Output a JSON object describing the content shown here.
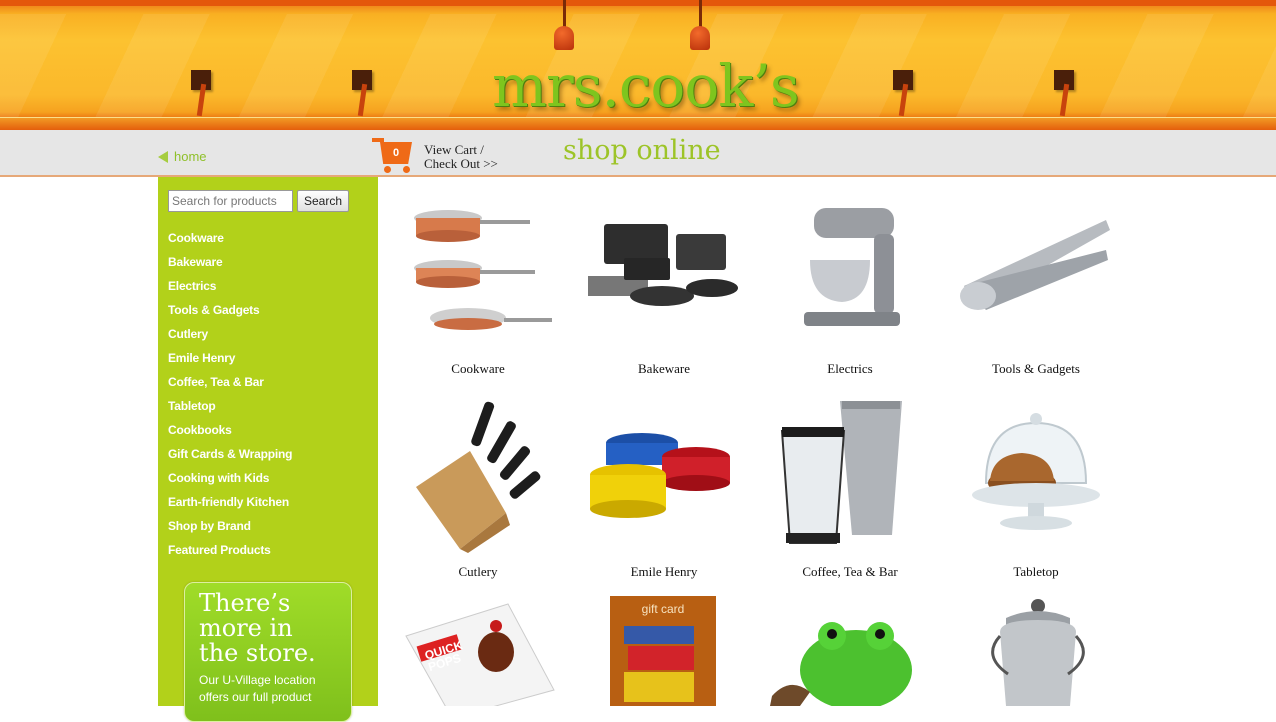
{
  "brand": {
    "logo_text": "mrs.cook’s"
  },
  "nav": {
    "home_label": "home",
    "cart_count": "0",
    "cart_line1": "View Cart /",
    "cart_line2": "Check Out >>",
    "section_title": "shop online"
  },
  "search": {
    "placeholder": "Search for products",
    "button_label": "Search"
  },
  "sidebar": {
    "categories": [
      "Cookware",
      "Bakeware",
      "Electrics",
      "Tools & Gadgets",
      "Cutlery",
      "Emile Henry",
      "Coffee, Tea & Bar",
      "Tabletop",
      "Cookbooks",
      "Gift Cards & Wrapping",
      "Cooking with Kids",
      "Earth-friendly Kitchen",
      "Shop by Brand",
      "Featured Products"
    ],
    "promo": {
      "headline_1": "There’s",
      "headline_2": "more in",
      "headline_3": "the store.",
      "body_1": "Our U-Village location",
      "body_2": "offers our full product"
    }
  },
  "products": [
    {
      "label": "Cookware"
    },
    {
      "label": "Bakeware"
    },
    {
      "label": "Electrics"
    },
    {
      "label": "Tools & Gadgets"
    },
    {
      "label": "Cutlery"
    },
    {
      "label": "Emile Henry"
    },
    {
      "label": "Coffee, Tea & Bar"
    },
    {
      "label": "Tabletop"
    },
    {
      "label": "",
      "thumb_text_1": "QUICK",
      "thumb_text_2": "POPS"
    },
    {
      "label": "",
      "thumb_text": "gift card"
    },
    {
      "label": ""
    },
    {
      "label": ""
    }
  ],
  "colors": {
    "accent_green": "#b2d11a",
    "accent_orange": "#ef6a17",
    "nav_gray": "#e6e6e6"
  }
}
